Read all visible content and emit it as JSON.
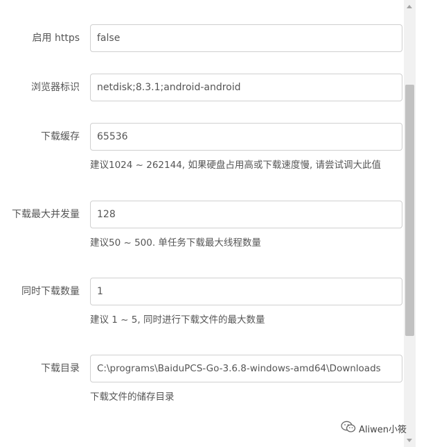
{
  "settings": {
    "https": {
      "label": "启用 https",
      "value": "false"
    },
    "user_agent": {
      "label": "浏览器标识",
      "value": "netdisk;8.3.1;android-android"
    },
    "cache_size": {
      "label": "下载缓存",
      "value": "65536",
      "help": "建议1024 ~ 262144, 如果硬盘占用高或下载速度慢, 请尝试调大此值"
    },
    "max_parallel": {
      "label": "下载最大并发量",
      "value": "128",
      "help": "建议50 ~ 500. 单任务下载最大线程数量"
    },
    "max_download_load": {
      "label": "同时下载数量",
      "value": "1",
      "help": "建议 1 ~ 5, 同时进行下载文件的最大数量"
    },
    "save_dir": {
      "label": "下载目录",
      "value": "C:\\programs\\BaiduPCS-Go-3.6.8-windows-amd64\\Downloads",
      "help": "下载文件的储存目录"
    }
  },
  "watermark": {
    "text": "Aliwen小筱",
    "icon": "wechat-icon"
  }
}
